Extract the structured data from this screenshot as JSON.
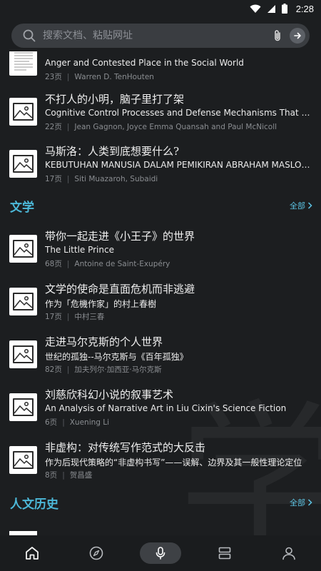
{
  "status_bar": {
    "time": "2:28"
  },
  "search": {
    "placeholder": "搜索文档、粘贴网址"
  },
  "top_books": [
    {
      "title": "……",
      "subtitle": "Anger and Contested Place in the Social World",
      "pages": "23页",
      "authors": "Warren D. TenHouten"
    },
    {
      "title": "不打人的小明，脑子里打了架",
      "subtitle": "Cognitive Control Processes and Defense Mechanisms That Influence …",
      "pages": "22页",
      "authors": "Jean Gagnon, Joyce Emma Quansah and Paul McNicoll"
    },
    {
      "title": "马斯洛：人类到底想要什么?",
      "subtitle": "KEBUTUHAN MANUSIA DALAM PEMIKIRAN ABRAHAM MASLOW (TIN…",
      "pages": "17页",
      "authors": "Siti Muazaroh, Subaidi"
    }
  ],
  "literature": {
    "name": "文学",
    "all_label": "全部",
    "books": [
      {
        "title": "带你一起走进《小王子》的世界",
        "subtitle": "The Little Prince",
        "pages": "68页",
        "authors": "Antoine de Saint-Exupéry"
      },
      {
        "title": "文学的使命是直面危机而非逃避",
        "subtitle": "作为「危機作家」的村上春樹",
        "pages": "17页",
        "authors": "中村三春"
      },
      {
        "title": "走进马尔克斯的个人世界",
        "subtitle": "世纪的孤独--马尔克斯与《百年孤独》",
        "pages": "82页",
        "authors": "加夫列尔·加西亚·马尔克斯"
      },
      {
        "title": "刘慈欣科幻小说的叙事艺术",
        "subtitle": "An Analysis of Narrative Art in Liu Cixin's Science Fiction",
        "pages": "6页",
        "authors": "Xuening Li"
      },
      {
        "title": "非虚构：对传统写作范式的大反击",
        "subtitle": "作为后现代策略的“非虚构书写”——误解、边界及其一般性理论定位",
        "pages": "8页",
        "authors": "贺昌盛"
      }
    ]
  },
  "humanities": {
    "name": "人文历史",
    "all_label": "全部"
  },
  "watermark": "学"
}
